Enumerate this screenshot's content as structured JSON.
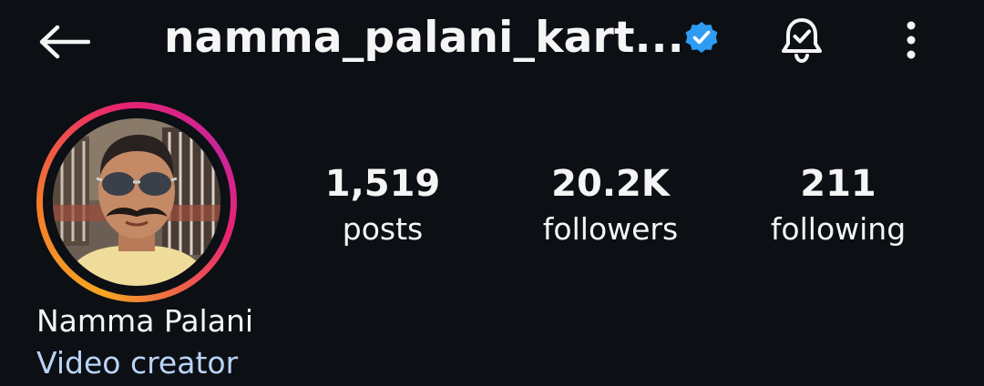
{
  "header": {
    "username": "namma_palani_kart...",
    "icons": {
      "back": "back-arrow-icon",
      "verified": "verified-badge-icon",
      "notifications": "bell-check-icon",
      "more": "more-vertical-icon"
    }
  },
  "profile": {
    "avatar": "profile-photo",
    "display_name": "Namma Palani",
    "category": "Video creator"
  },
  "stats": [
    {
      "value": "1,519",
      "label": "posts"
    },
    {
      "value": "20.2K",
      "label": "followers"
    },
    {
      "value": "211",
      "label": "following"
    }
  ],
  "colors": {
    "background": "#0c0f14",
    "text": "#f5f5f5",
    "verified_blue": "#2f9cf4",
    "category_text": "#b9d4f7",
    "story_ring_start": "#f5a623",
    "story_ring_end": "#c8259b"
  }
}
